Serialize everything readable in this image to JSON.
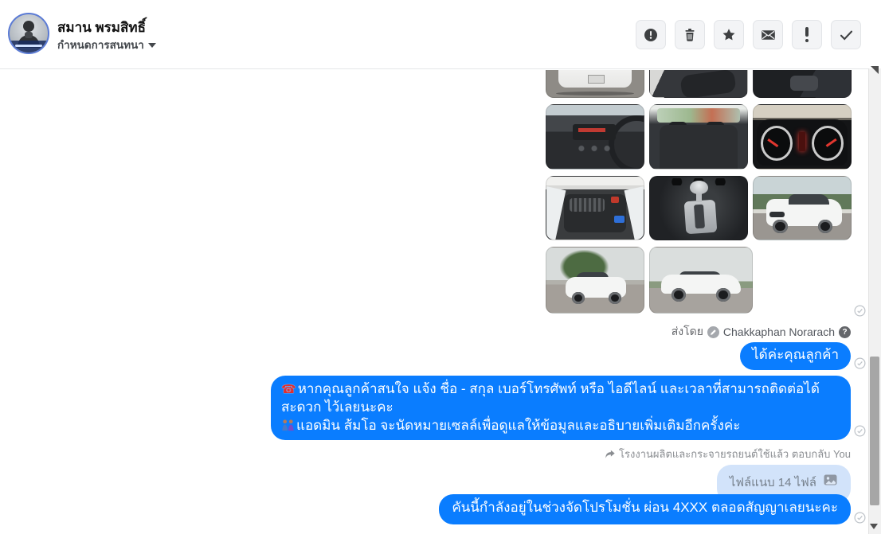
{
  "header": {
    "name": "สมาน พรมสิทธิ์",
    "subtitle": "กำหนดการสนทนา"
  },
  "toolbar": {
    "buttons": [
      {
        "name": "report",
        "icon": "exclamation-circle-icon"
      },
      {
        "name": "delete",
        "icon": "trash-icon"
      },
      {
        "name": "star",
        "icon": "star-icon"
      },
      {
        "name": "envelope",
        "icon": "envelope-icon"
      },
      {
        "name": "mark-important",
        "icon": "exclamation-icon"
      },
      {
        "name": "mark-done",
        "icon": "check-icon"
      }
    ]
  },
  "icons": {
    "phone": "☎",
    "question": "?"
  },
  "conversation": {
    "attachments": [
      "car-rear-cropped",
      "front-seats-cropped",
      "center-console-cropped",
      "dashboard-radio",
      "rear-seats",
      "gauge-cluster",
      "engine-bay",
      "gear-shifter",
      "car-front-quarter",
      "car-rear-quarter-tree",
      "car-side-view"
    ],
    "sent_by": {
      "prefix": "ส่งโดย",
      "name": "Chakkaphan Norarach"
    },
    "messages": {
      "reply1": {
        "text": "ได้ค่ะคุณลูกค้า"
      },
      "info": {
        "line1": "หากคุณลูกค้าสนใจ แจ้ง ชื่อ - สกุล เบอร์โทรศัพท์ หรือ ไอดีไลน์ และเวลาที่สามารถติดต่อได้สะดวก ไว้เลยนะคะ",
        "line2": "แอดมิน ส้มโอ จะนัดหมายเซลล์เพื่อดูแลให้ข้อมูลและอธิบายเพิ่มเติมอีกครั้งค่ะ"
      },
      "reply_context": {
        "text": "โรงงานผลิตและกระจายรถยนต์ใช้แล้ว ตอบกลับ You"
      },
      "quoted_attachment": {
        "text": "ไฟล์แนบ 14 ไฟล์"
      },
      "promo": {
        "text": "คันนี้กำลังอยู่ในช่วงจัดโปรโมชั่น ผ่อน 4XXX ตลอดสัญญาเลยนะคะ"
      }
    }
  },
  "colors": {
    "accent": "#0a7dff",
    "quoted_bubble": "#d2e3fa",
    "meta_text": "#8a8d91",
    "icon_dark": "#3e4042"
  }
}
